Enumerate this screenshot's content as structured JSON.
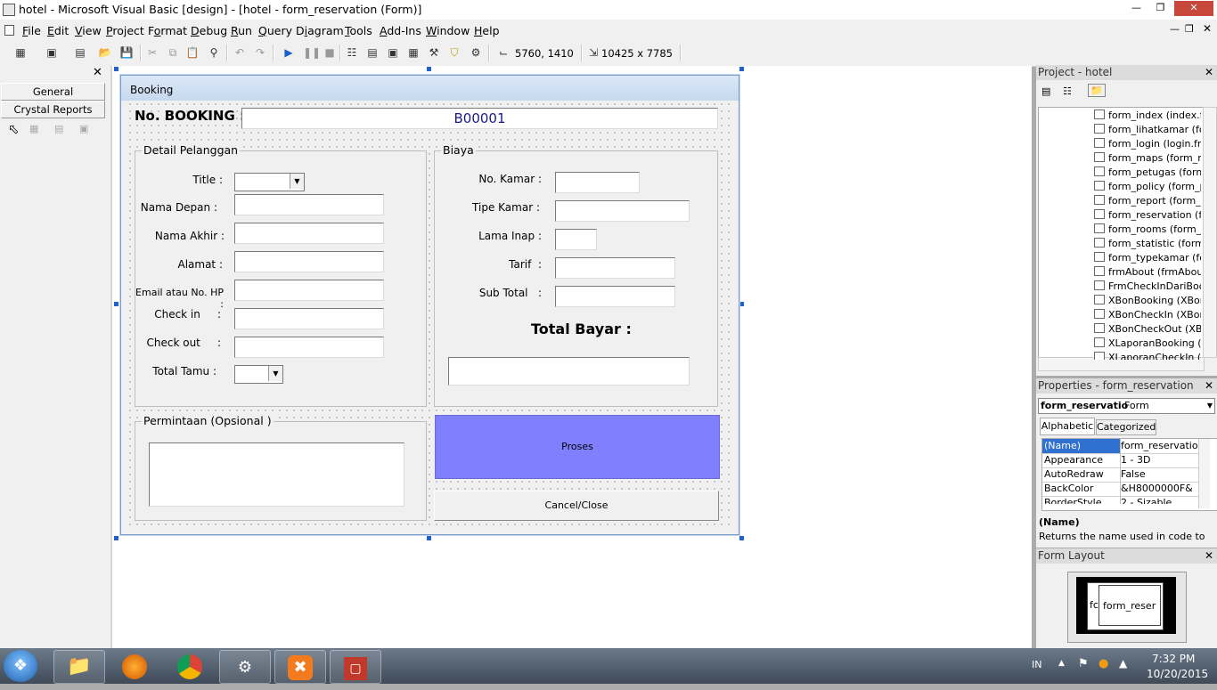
{
  "window": {
    "title": "hotel - Microsoft Visual Basic [design] - [hotel - form_reservation (Form)]"
  },
  "menu": [
    {
      "label": "File",
      "u": "F"
    },
    {
      "label": "Edit",
      "u": "E"
    },
    {
      "label": "View",
      "u": "V"
    },
    {
      "label": "Project",
      "u": "P"
    },
    {
      "label": "Format",
      "u": "o"
    },
    {
      "label": "Debug",
      "u": "D"
    },
    {
      "label": "Run",
      "u": "R"
    },
    {
      "label": "Query",
      "u": "Q"
    },
    {
      "label": "Diagram",
      "u": "i"
    },
    {
      "label": "Tools",
      "u": "T"
    },
    {
      "label": "Add-Ins",
      "u": "A"
    },
    {
      "label": "Window",
      "u": "W"
    },
    {
      "label": "Help",
      "u": "H"
    }
  ],
  "toolbar": {
    "position": "5760, 1410",
    "size": "10425 x 7785"
  },
  "toolbox": {
    "general_tab": "General",
    "crystal_tab": "Crystal Reports"
  },
  "form": {
    "caption": "Booking",
    "booking_label": "No. BOOKING :",
    "booking_value": "B00001",
    "detail_frame": "Detail Pelanggan",
    "labels": {
      "title": "Title   :",
      "nama_depan": "Nama Depan :",
      "nama_akhir": "Nama Akhir :",
      "alamat": "Alamat :",
      "email": "Email atau No. HP :",
      "check_in": "Check in     :",
      "check_out": "Check out     :",
      "total_tamu": "Total Tamu :"
    },
    "biaya_frame": "Biaya",
    "biaya_labels": {
      "no_kamar": "No. Kamar :",
      "tipe_kamar": "Tipe Kamar :",
      "lama_inap": "Lama Inap :",
      "tarif": "Tarif  :",
      "sub_total": "Sub Total   :",
      "total_bayar": "Total Bayar :"
    },
    "permintaan_frame": "Permintaan (Opsional )",
    "proses_button": "Proses",
    "cancel_button": "Cancel/Close"
  },
  "project": {
    "title": "Project - hotel",
    "items": [
      "form_index (index.frm",
      "form_lihatkamar (form",
      "form_login (login.frm)",
      "form_maps (form_map",
      "form_petugas (form_p",
      "form_policy (form_pol",
      "form_report (form_re",
      "form_reservation (form",
      "form_rooms (form_roo",
      "form_statistic (form_s",
      "form_typekamar (form",
      "frmAbout (frmAbout.f",
      "FrmCheckInDariBookin",
      "XBonBooking (XBonBo",
      "XBonCheckIn (XBonCh",
      "XBonCheckOut (XBonC",
      "XLaporanBooking (XLa",
      "XLaporanCheckIn (XL"
    ]
  },
  "properties": {
    "title": "Properties - form_reservation",
    "object": "form_reservatio",
    "object_type": "Form",
    "tabs": [
      "Alphabetic",
      "Categorized"
    ],
    "rows": [
      {
        "k": "(Name)",
        "v": "form_reservation"
      },
      {
        "k": "Appearance",
        "v": "1 - 3D"
      },
      {
        "k": "AutoRedraw",
        "v": "False"
      },
      {
        "k": "BackColor",
        "v": "&H8000000F&"
      },
      {
        "k": "BorderStyle",
        "v": "2 - Sizable"
      }
    ],
    "desc_title": "(Name)",
    "desc_text": "Returns the name used in code to"
  },
  "form_layout": {
    "title": "Form Layout",
    "preview_label": "form_reser",
    "preview_small": "fc"
  },
  "tray": {
    "lang": "IN",
    "time": "7:32 PM",
    "date": "10/20/2015"
  },
  "colors": {
    "proses_bg": "#8080ff",
    "booking_value": "#1a1a8c"
  }
}
